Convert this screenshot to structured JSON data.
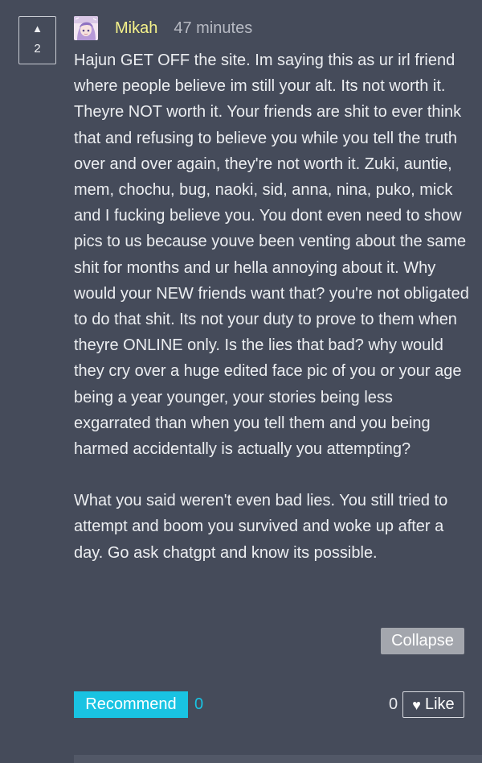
{
  "comment": {
    "votes": {
      "arrow": "▲",
      "count": "2"
    },
    "author": {
      "name": "Mikah",
      "time": "47 minutes"
    },
    "paragraphs": [
      "Hajun GET OFF the site. Im saying this as ur irl friend where people believe im still your alt. Its not worth it. Theyre NOT worth it. Your friends are shit to ever think that and refusing to believe you while you tell the truth over and over again, they're not worth it. Zuki, auntie, mem, chochu, bug, naoki, sid, anna, nina, puko, mick and I fucking believe you. You dont even need to show pics to us because youve been venting about the same shit for months and ur hella annoying about it. Why would your NEW friends want that? you're not obligated to do that shit. Its not your duty to prove to them when theyre ONLINE only. Is the lies that bad? why would they cry over a huge edited face pic of you or your age being a year younger, your stories being less exgarrated than when you tell them and you being harmed accidentally is actually you attempting?",
      "What you said weren't even bad lies. You still tried to attempt and boom you survived and woke up after a day. Go ask chatgpt and know its possible."
    ],
    "collapse_label": "Collapse",
    "recommend_label": "Recommend",
    "recommend_count": "0",
    "like_count": "0",
    "like_label": "Like",
    "like_icon": "♥",
    "colors": {
      "background": "#454b5a",
      "username": "#f5f28a",
      "accent": "#19c3e2",
      "collapse_bg": "#a3a6ad"
    },
    "icons": {
      "upvote": "upvote-arrow-icon",
      "avatar": "anime-avatar",
      "like": "heart-icon"
    }
  }
}
